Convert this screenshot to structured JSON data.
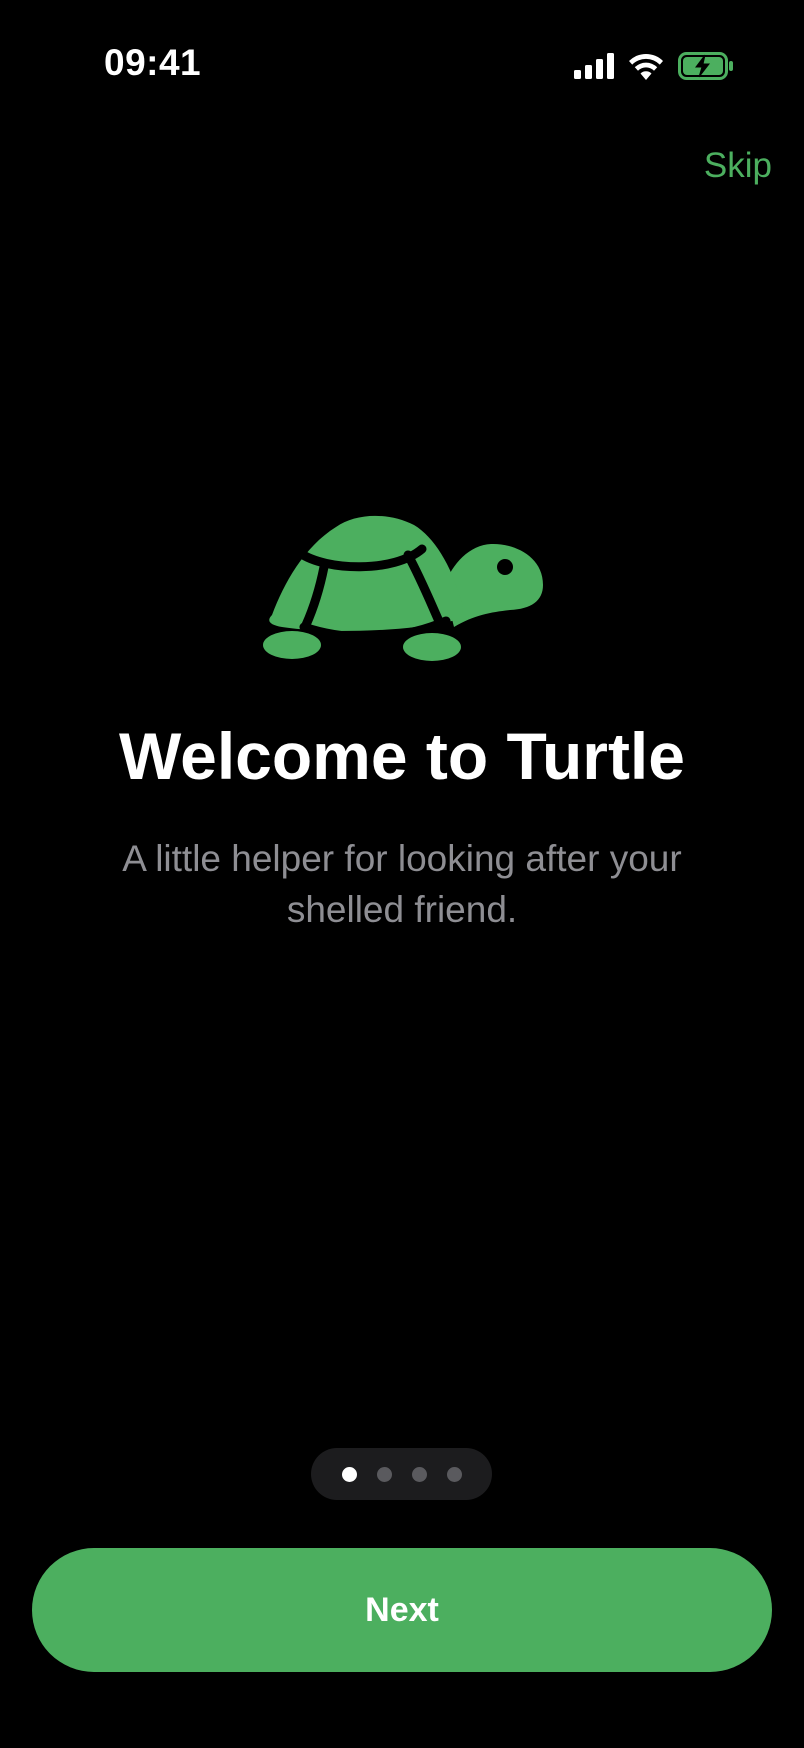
{
  "status_bar": {
    "time": "09:41",
    "icons": [
      "cellular-signal-icon",
      "wifi-icon",
      "battery-charging-icon"
    ]
  },
  "header": {
    "skip_label": "Skip"
  },
  "hero": {
    "icon": "turtle-icon",
    "title": "Welcome to Turtle",
    "subtitle": "A little helper for looking after your shelled friend."
  },
  "pager": {
    "total_pages": 4,
    "current_page": 1
  },
  "footer": {
    "next_label": "Next"
  },
  "colors": {
    "accent": "#4caf5f",
    "background": "#000000",
    "text_primary": "#ffffff",
    "text_secondary": "#8e8e93",
    "pager_background": "#1c1c1e",
    "dot_inactive": "#5a5a5e"
  }
}
